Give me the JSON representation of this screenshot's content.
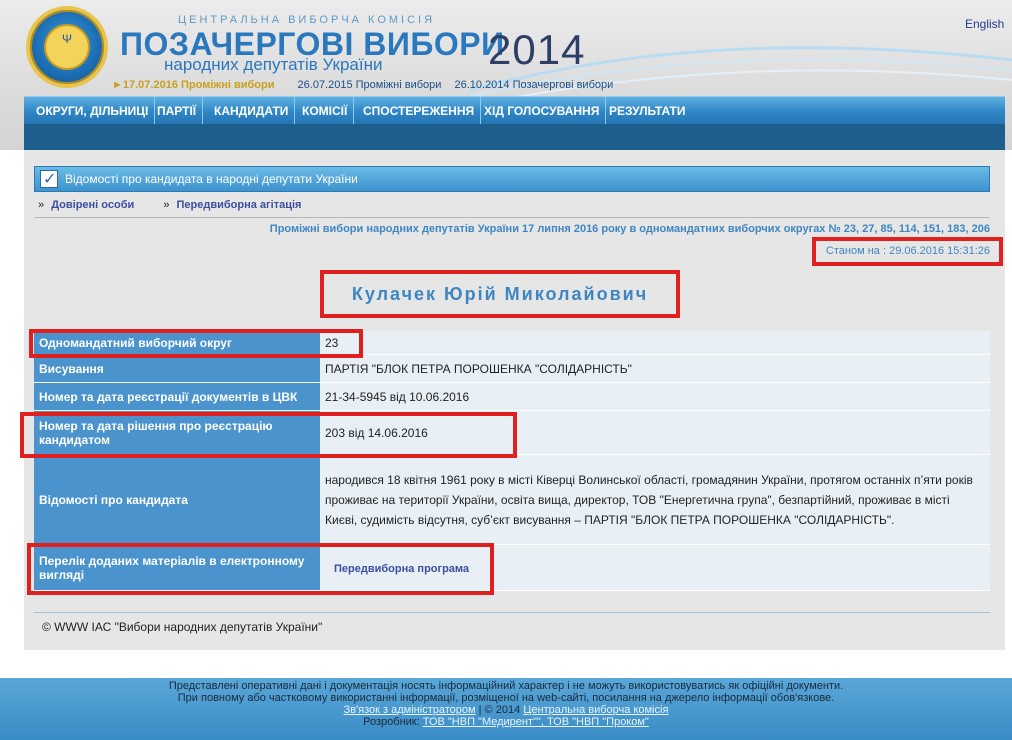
{
  "header": {
    "org_name": "ЦЕНТРАЛЬНА ВИБОРЧА КОМІСІЯ",
    "title": "ПОЗАЧЕРГОВІ ВИБОРИ",
    "subtitle": "народних депутатів України",
    "year": "2014",
    "language_link": "English",
    "elections": [
      {
        "label": "17.07.2016 Проміжні вибори",
        "current": true
      },
      {
        "label": "26.07.2015 Проміжні вибори",
        "current": false
      },
      {
        "label": "26.10.2014 Позачергові вибори",
        "current": false
      }
    ]
  },
  "nav": {
    "items": [
      "ОКРУГИ, ДІЛЬНИЦІ",
      "ПАРТІЇ",
      "КАНДИДАТИ",
      "КОМІСІЇ",
      "СПОСТЕРЕЖЕННЯ",
      "ХІД ГОЛОСУВАННЯ",
      "РЕЗУЛЬТАТИ"
    ]
  },
  "panel": {
    "title": "Відомості про кандидата в народні депутати України",
    "links": [
      "Довірені особи",
      "Передвиборна агітація"
    ]
  },
  "election_line": "Проміжні вибори народних депутатів України 17 липня 2016 року в одномандатних виборчих округах № 23, 27, 85, 114, 151, 183, 206",
  "status": "Станом на : 29.06.2016 15:31:26",
  "candidate_name": "Кулачек Юрій Миколайович",
  "rows": [
    {
      "label": "Одномандатний виборчий округ",
      "value": "23"
    },
    {
      "label": "Висування",
      "value": "ПАРТІЯ \"БЛОК ПЕТРА ПОРОШЕНКА \"СОЛІДАРНІСТЬ\""
    },
    {
      "label": "Номер та дата реєстрації документів в ЦВК",
      "value": "21-34-5945 від 10.06.2016"
    },
    {
      "label": "Номер та дата рішення про реєстрацію кандидатом",
      "value": "203 від 14.06.2016"
    },
    {
      "label": "Відомості про кандидата",
      "value": "народився 18 квітня 1961 року в місті Ківерці Волинської області, громадянин України, протягом останніх п’яти років проживає на території України, освіта вища, директор, ТОВ \"Енергетична група\", безпартійний, проживає в місті Києві, судимість відсутня, суб’єкт висування – ПАРТІЯ \"БЛОК ПЕТРА ПОРОШЕНКА \"СОЛІДАРНІСТЬ\"."
    },
    {
      "label": "Перелік доданих матеріалів в електронному вигляді",
      "value": "Передвиборна програма"
    }
  ],
  "copyright": "© WWW ІАС \"Вибори народних депутатів України\"",
  "footer": {
    "line1": "Представлені оперативні дані і документація носять інформаційний характер і не можуть використовуватись як офіційні документи.",
    "line2": "При повному або частковому використанні інформації, розміщеної на web-сайті, посилання на джерело інформації обов'язкове.",
    "contact_link": "Зв'язок з адміністратором",
    "copyright_prefix": "| © 2014",
    "cec_link": "Центральна виборча комісія",
    "developer_label": "Розробник:",
    "developer_link": "ТОВ \"НВП \"Медирент\"\", ТОВ \"НВП \"Проком\""
  },
  "colors": {
    "accent_blue": "#2a78bd",
    "nav_blue": "#2f86c6",
    "label_blue": "#4a93cd",
    "annotation_red": "#e0201e"
  }
}
